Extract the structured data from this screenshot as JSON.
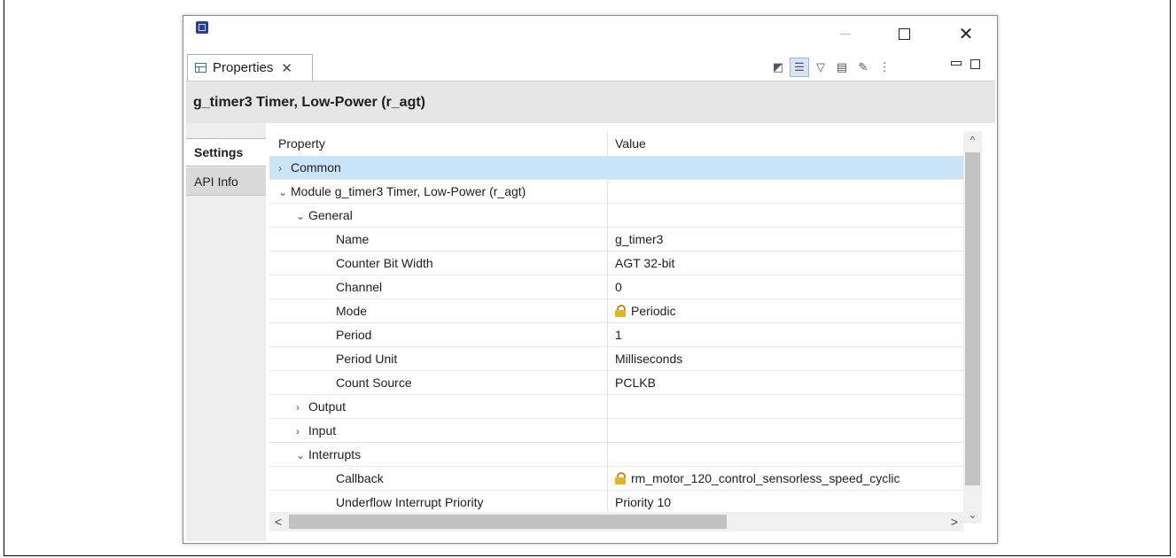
{
  "window": {
    "app_icon": "e2-studio-icon",
    "controls": {
      "minimize": "—",
      "maximize": "☐",
      "close": "✕"
    }
  },
  "view": {
    "tab_label": "Properties",
    "tab_close": "✕",
    "toolbar_icons": [
      "pin-to-selection-icon",
      "show-categories-icon",
      "filter-icon",
      "show-advanced-icon",
      "restore-default-icon",
      "view-menu-icon"
    ]
  },
  "page_title": "g_timer3 Timer, Low-Power (r_agt)",
  "side_tabs": [
    "Settings",
    "API Info"
  ],
  "table": {
    "columns": [
      "Property",
      "Value"
    ],
    "rows": [
      {
        "key": "Common",
        "value": "",
        "level": 0,
        "twisty": "›",
        "selected": true
      },
      {
        "key": "Module g_timer3 Timer, Low-Power (r_agt)",
        "value": "",
        "level": 0,
        "twisty": "⌄"
      },
      {
        "key": "General",
        "value": "",
        "level": 1,
        "twisty": "⌄"
      },
      {
        "key": "Name",
        "value": "g_timer3",
        "level": 2
      },
      {
        "key": "Counter Bit Width",
        "value": "AGT 32-bit",
        "level": 2
      },
      {
        "key": "Channel",
        "value": "0",
        "level": 2
      },
      {
        "key": "Mode",
        "value": "Periodic",
        "level": 2,
        "locked": true
      },
      {
        "key": "Period",
        "value": "1",
        "level": 2
      },
      {
        "key": "Period Unit",
        "value": "Milliseconds",
        "level": 2
      },
      {
        "key": "Count Source",
        "value": "PCLKB",
        "level": 2
      },
      {
        "key": "Output",
        "value": "",
        "level": 1,
        "twisty": "›"
      },
      {
        "key": "Input",
        "value": "",
        "level": 1,
        "twisty": "›"
      },
      {
        "key": "Interrupts",
        "value": "",
        "level": 1,
        "twisty": "⌄"
      },
      {
        "key": "Callback",
        "value": "rm_motor_120_control_sensorless_speed_cyclic",
        "level": 2,
        "locked": true
      },
      {
        "key": "Underflow Interrupt Priority",
        "value": "Priority 10",
        "level": 2
      }
    ]
  },
  "scroll": {
    "up": "^",
    "down": "⌄",
    "left": "<",
    "right": ">"
  }
}
